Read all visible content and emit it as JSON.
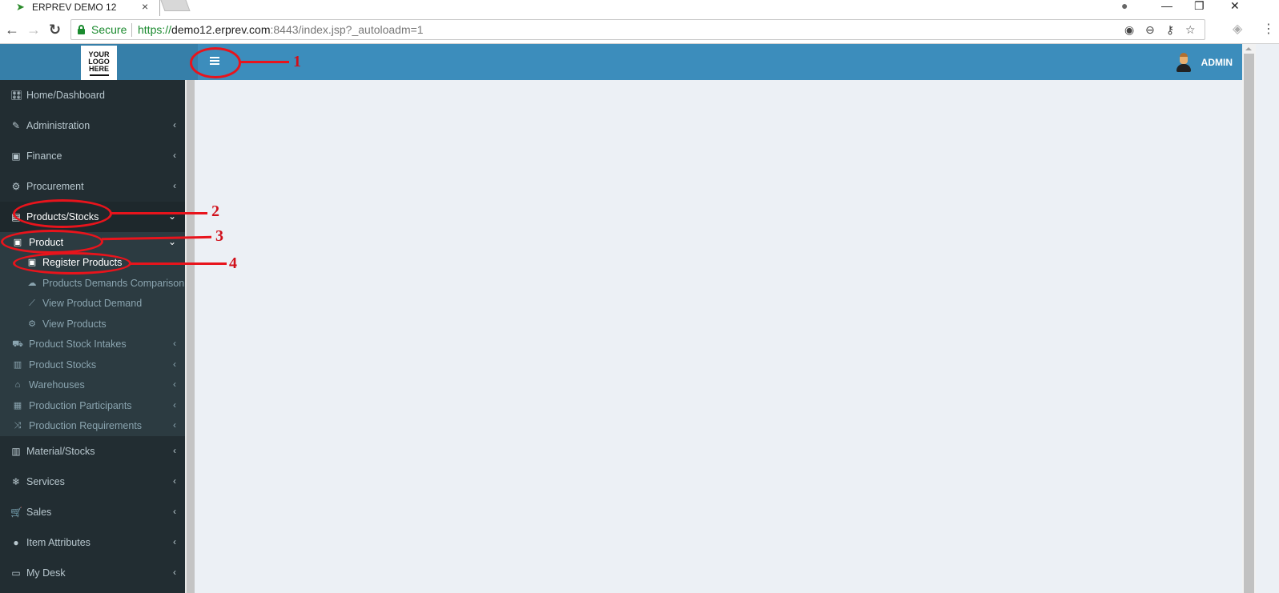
{
  "browser": {
    "tab": {
      "title": "ERPREV DEMO 12",
      "icon": "bird-favicon",
      "close": "×"
    },
    "window_controls": {
      "account": "●",
      "minimize": "—",
      "restore": "❐",
      "close": "✕"
    },
    "nav": {
      "back": "←",
      "forward": "→",
      "reload": "↻"
    },
    "omnibox": {
      "security_label": "Secure",
      "url_scheme": "https://",
      "url_host": "demo12.erprev.com",
      "url_rest": ":8443/index.jsp?_autoloadm=1"
    },
    "omnibox_icons": {
      "location": "◉",
      "zoom": "⊖",
      "key": "⚷",
      "bookmark": "☆"
    },
    "extension_icon": "◈",
    "menu_icon": "⋮"
  },
  "app": {
    "logo": {
      "line1": "YOUR",
      "line2": "LOGO",
      "line3": "HERE"
    },
    "user": {
      "name": "ADMIN"
    }
  },
  "sidebar": {
    "items": [
      {
        "label": "Home/Dashboard",
        "icon": "🎛",
        "chevron": ""
      },
      {
        "label": "Administration",
        "icon": "✎",
        "chevron": "‹"
      },
      {
        "label": "Finance",
        "icon": "▣",
        "chevron": "‹"
      },
      {
        "label": "Procurement",
        "icon": "⚙",
        "chevron": "‹"
      },
      {
        "label": "Products/Stocks",
        "icon": "▤",
        "chevron": "⌄"
      }
    ],
    "products_submenu": {
      "product": {
        "label": "Product",
        "icon": "▣",
        "chevron": "⌄"
      },
      "product_children": [
        {
          "label": "Register Products",
          "icon": "▣"
        },
        {
          "label": "Products Demands Comparison",
          "icon": "☁"
        },
        {
          "label": "View Product Demand",
          "icon": "⟋"
        },
        {
          "label": "View Products",
          "icon": "⚙"
        }
      ],
      "others": [
        {
          "label": "Product Stock Intakes",
          "icon": "⛟",
          "chevron": "‹"
        },
        {
          "label": "Product Stocks",
          "icon": "▥",
          "chevron": "‹"
        },
        {
          "label": "Warehouses",
          "icon": "⌂",
          "chevron": "‹"
        },
        {
          "label": "Production Participants",
          "icon": "▦",
          "chevron": "‹"
        },
        {
          "label": "Production Requirements",
          "icon": "⤨",
          "chevron": "‹"
        }
      ]
    },
    "bottom_items": [
      {
        "label": "Material/Stocks",
        "icon": "▥",
        "chevron": "‹"
      },
      {
        "label": "Services",
        "icon": "❄",
        "chevron": "‹"
      },
      {
        "label": "Sales",
        "icon": "🛒",
        "chevron": "‹"
      },
      {
        "label": "Item Attributes",
        "icon": "●",
        "chevron": "‹"
      },
      {
        "label": "My Desk",
        "icon": "▭",
        "chevron": "‹"
      }
    ]
  },
  "annotations": [
    {
      "number": "1",
      "target": "menu-toggle"
    },
    {
      "number": "2",
      "target": "Products/Stocks"
    },
    {
      "number": "3",
      "target": "Product"
    },
    {
      "number": "4",
      "target": "Register Products"
    }
  ],
  "colors": {
    "header": "#3c8dbc",
    "logo_area": "#367fa9",
    "sidebar": "#222d32",
    "submenu": "#2c3b41",
    "content": "#ecf0f5",
    "annotation": "#e8141c",
    "secure": "#1a8a2e"
  }
}
